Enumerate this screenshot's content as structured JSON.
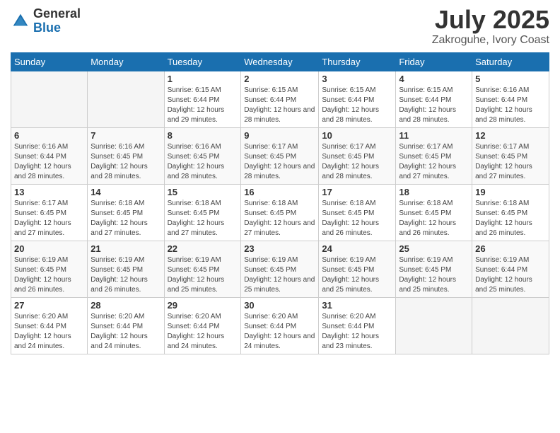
{
  "logo": {
    "general": "General",
    "blue": "Blue"
  },
  "header": {
    "month": "July 2025",
    "location": "Zakroguhe, Ivory Coast"
  },
  "weekdays": [
    "Sunday",
    "Monday",
    "Tuesday",
    "Wednesday",
    "Thursday",
    "Friday",
    "Saturday"
  ],
  "weeks": [
    [
      {
        "day": "",
        "info": ""
      },
      {
        "day": "",
        "info": ""
      },
      {
        "day": "1",
        "info": "Sunrise: 6:15 AM\nSunset: 6:44 PM\nDaylight: 12 hours and 29 minutes."
      },
      {
        "day": "2",
        "info": "Sunrise: 6:15 AM\nSunset: 6:44 PM\nDaylight: 12 hours and 28 minutes."
      },
      {
        "day": "3",
        "info": "Sunrise: 6:15 AM\nSunset: 6:44 PM\nDaylight: 12 hours and 28 minutes."
      },
      {
        "day": "4",
        "info": "Sunrise: 6:15 AM\nSunset: 6:44 PM\nDaylight: 12 hours and 28 minutes."
      },
      {
        "day": "5",
        "info": "Sunrise: 6:16 AM\nSunset: 6:44 PM\nDaylight: 12 hours and 28 minutes."
      }
    ],
    [
      {
        "day": "6",
        "info": "Sunrise: 6:16 AM\nSunset: 6:44 PM\nDaylight: 12 hours and 28 minutes."
      },
      {
        "day": "7",
        "info": "Sunrise: 6:16 AM\nSunset: 6:45 PM\nDaylight: 12 hours and 28 minutes."
      },
      {
        "day": "8",
        "info": "Sunrise: 6:16 AM\nSunset: 6:45 PM\nDaylight: 12 hours and 28 minutes."
      },
      {
        "day": "9",
        "info": "Sunrise: 6:17 AM\nSunset: 6:45 PM\nDaylight: 12 hours and 28 minutes."
      },
      {
        "day": "10",
        "info": "Sunrise: 6:17 AM\nSunset: 6:45 PM\nDaylight: 12 hours and 28 minutes."
      },
      {
        "day": "11",
        "info": "Sunrise: 6:17 AM\nSunset: 6:45 PM\nDaylight: 12 hours and 27 minutes."
      },
      {
        "day": "12",
        "info": "Sunrise: 6:17 AM\nSunset: 6:45 PM\nDaylight: 12 hours and 27 minutes."
      }
    ],
    [
      {
        "day": "13",
        "info": "Sunrise: 6:17 AM\nSunset: 6:45 PM\nDaylight: 12 hours and 27 minutes."
      },
      {
        "day": "14",
        "info": "Sunrise: 6:18 AM\nSunset: 6:45 PM\nDaylight: 12 hours and 27 minutes."
      },
      {
        "day": "15",
        "info": "Sunrise: 6:18 AM\nSunset: 6:45 PM\nDaylight: 12 hours and 27 minutes."
      },
      {
        "day": "16",
        "info": "Sunrise: 6:18 AM\nSunset: 6:45 PM\nDaylight: 12 hours and 27 minutes."
      },
      {
        "day": "17",
        "info": "Sunrise: 6:18 AM\nSunset: 6:45 PM\nDaylight: 12 hours and 26 minutes."
      },
      {
        "day": "18",
        "info": "Sunrise: 6:18 AM\nSunset: 6:45 PM\nDaylight: 12 hours and 26 minutes."
      },
      {
        "day": "19",
        "info": "Sunrise: 6:18 AM\nSunset: 6:45 PM\nDaylight: 12 hours and 26 minutes."
      }
    ],
    [
      {
        "day": "20",
        "info": "Sunrise: 6:19 AM\nSunset: 6:45 PM\nDaylight: 12 hours and 26 minutes."
      },
      {
        "day": "21",
        "info": "Sunrise: 6:19 AM\nSunset: 6:45 PM\nDaylight: 12 hours and 26 minutes."
      },
      {
        "day": "22",
        "info": "Sunrise: 6:19 AM\nSunset: 6:45 PM\nDaylight: 12 hours and 25 minutes."
      },
      {
        "day": "23",
        "info": "Sunrise: 6:19 AM\nSunset: 6:45 PM\nDaylight: 12 hours and 25 minutes."
      },
      {
        "day": "24",
        "info": "Sunrise: 6:19 AM\nSunset: 6:45 PM\nDaylight: 12 hours and 25 minutes."
      },
      {
        "day": "25",
        "info": "Sunrise: 6:19 AM\nSunset: 6:45 PM\nDaylight: 12 hours and 25 minutes."
      },
      {
        "day": "26",
        "info": "Sunrise: 6:19 AM\nSunset: 6:44 PM\nDaylight: 12 hours and 25 minutes."
      }
    ],
    [
      {
        "day": "27",
        "info": "Sunrise: 6:20 AM\nSunset: 6:44 PM\nDaylight: 12 hours and 24 minutes."
      },
      {
        "day": "28",
        "info": "Sunrise: 6:20 AM\nSunset: 6:44 PM\nDaylight: 12 hours and 24 minutes."
      },
      {
        "day": "29",
        "info": "Sunrise: 6:20 AM\nSunset: 6:44 PM\nDaylight: 12 hours and 24 minutes."
      },
      {
        "day": "30",
        "info": "Sunrise: 6:20 AM\nSunset: 6:44 PM\nDaylight: 12 hours and 24 minutes."
      },
      {
        "day": "31",
        "info": "Sunrise: 6:20 AM\nSunset: 6:44 PM\nDaylight: 12 hours and 23 minutes."
      },
      {
        "day": "",
        "info": ""
      },
      {
        "day": "",
        "info": ""
      }
    ]
  ]
}
